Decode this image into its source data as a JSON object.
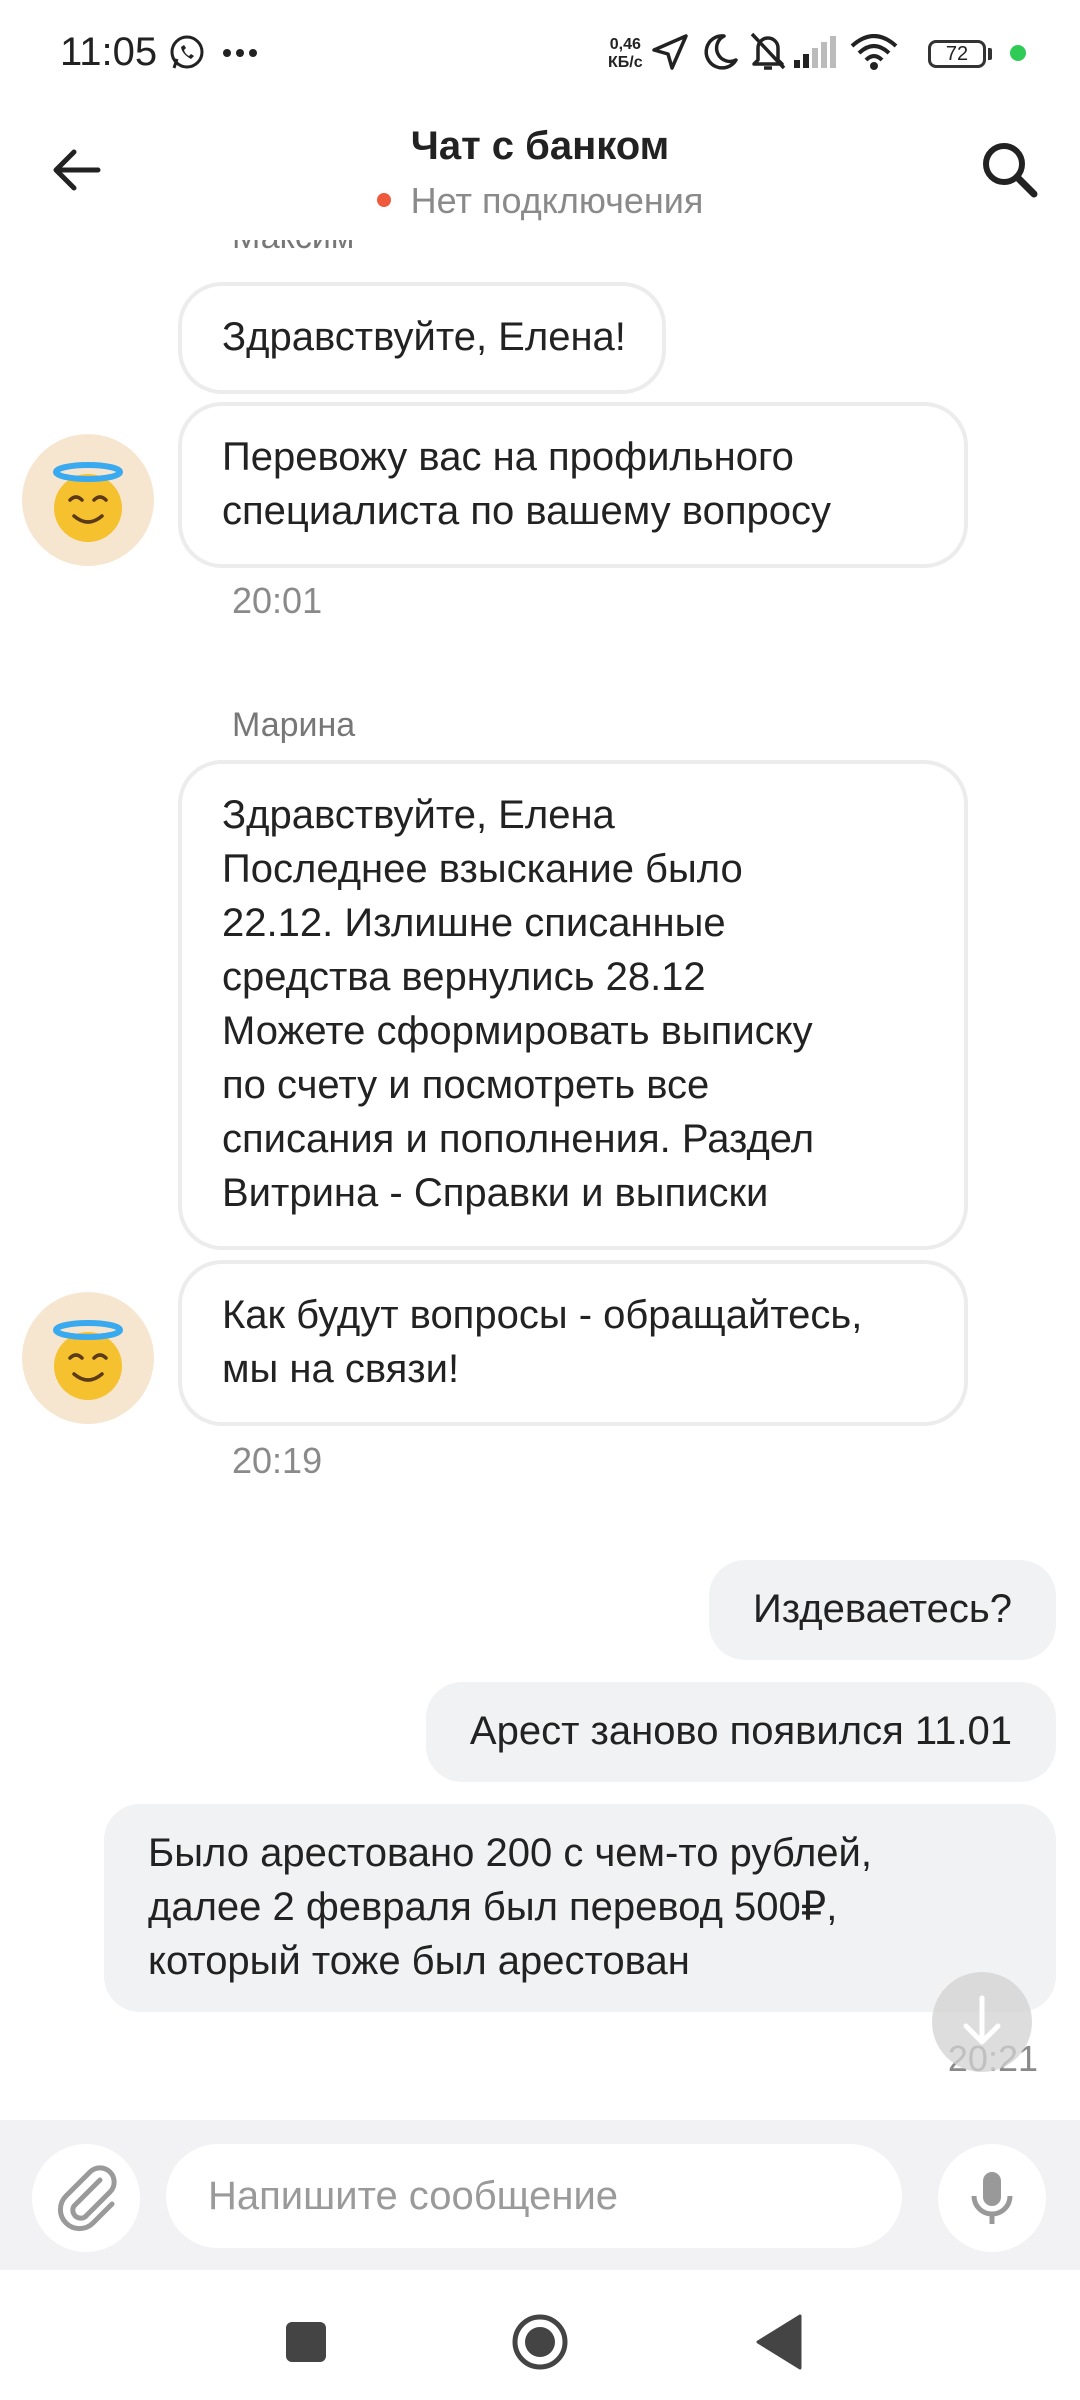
{
  "status_bar": {
    "time": "11:05",
    "network_speed_value": "0,46",
    "network_speed_unit": "КБ/с",
    "battery": "72",
    "icons": [
      "whatsapp-icon",
      "more-dots-icon",
      "location-arrow-icon",
      "moon-icon",
      "bell-off-icon",
      "signal-icon",
      "wifi-icon",
      "battery-icon"
    ]
  },
  "header": {
    "title": "Чат с банком",
    "status": "Нет подключения",
    "status_color": "#f05a3c"
  },
  "messages": {
    "m1": {
      "sender": "Максим",
      "bubble1": "Здравствуйте, Елена!",
      "bubble2": "Перевожу вас на профильного\nспециалиста по вашему вопросу",
      "time": "20:01"
    },
    "m2": {
      "sender": "Марина",
      "bubble1": "Здравствуйте, Елена\nПоследнее взыскание было\n22.12. Излишне списанные\nсредства вернулись 28.12\nМожете сформировать выписку\nпо счету и посмотреть все\nсписания и пополнения. Раздел\nВитрина - Справки и выписки",
      "bubble2": "Как будут вопросы - обращайтесь,\nмы на связи!",
      "time": "20:19"
    },
    "out": {
      "bubble1": "Издеваетесь?",
      "bubble2": "Арест заново появился 11.01",
      "bubble3": "Было арестовано 200 с чем-то рублей,\nдалее 2 февраля был перевод 500₽,\nкоторый тоже был арестован",
      "time": "20:21"
    }
  },
  "composer": {
    "placeholder": "Напишите сообщение"
  },
  "colors": {
    "incoming_border": "#ececec",
    "outgoing_bg": "#f1f2f4",
    "composer_bg": "#f2f2f4"
  }
}
